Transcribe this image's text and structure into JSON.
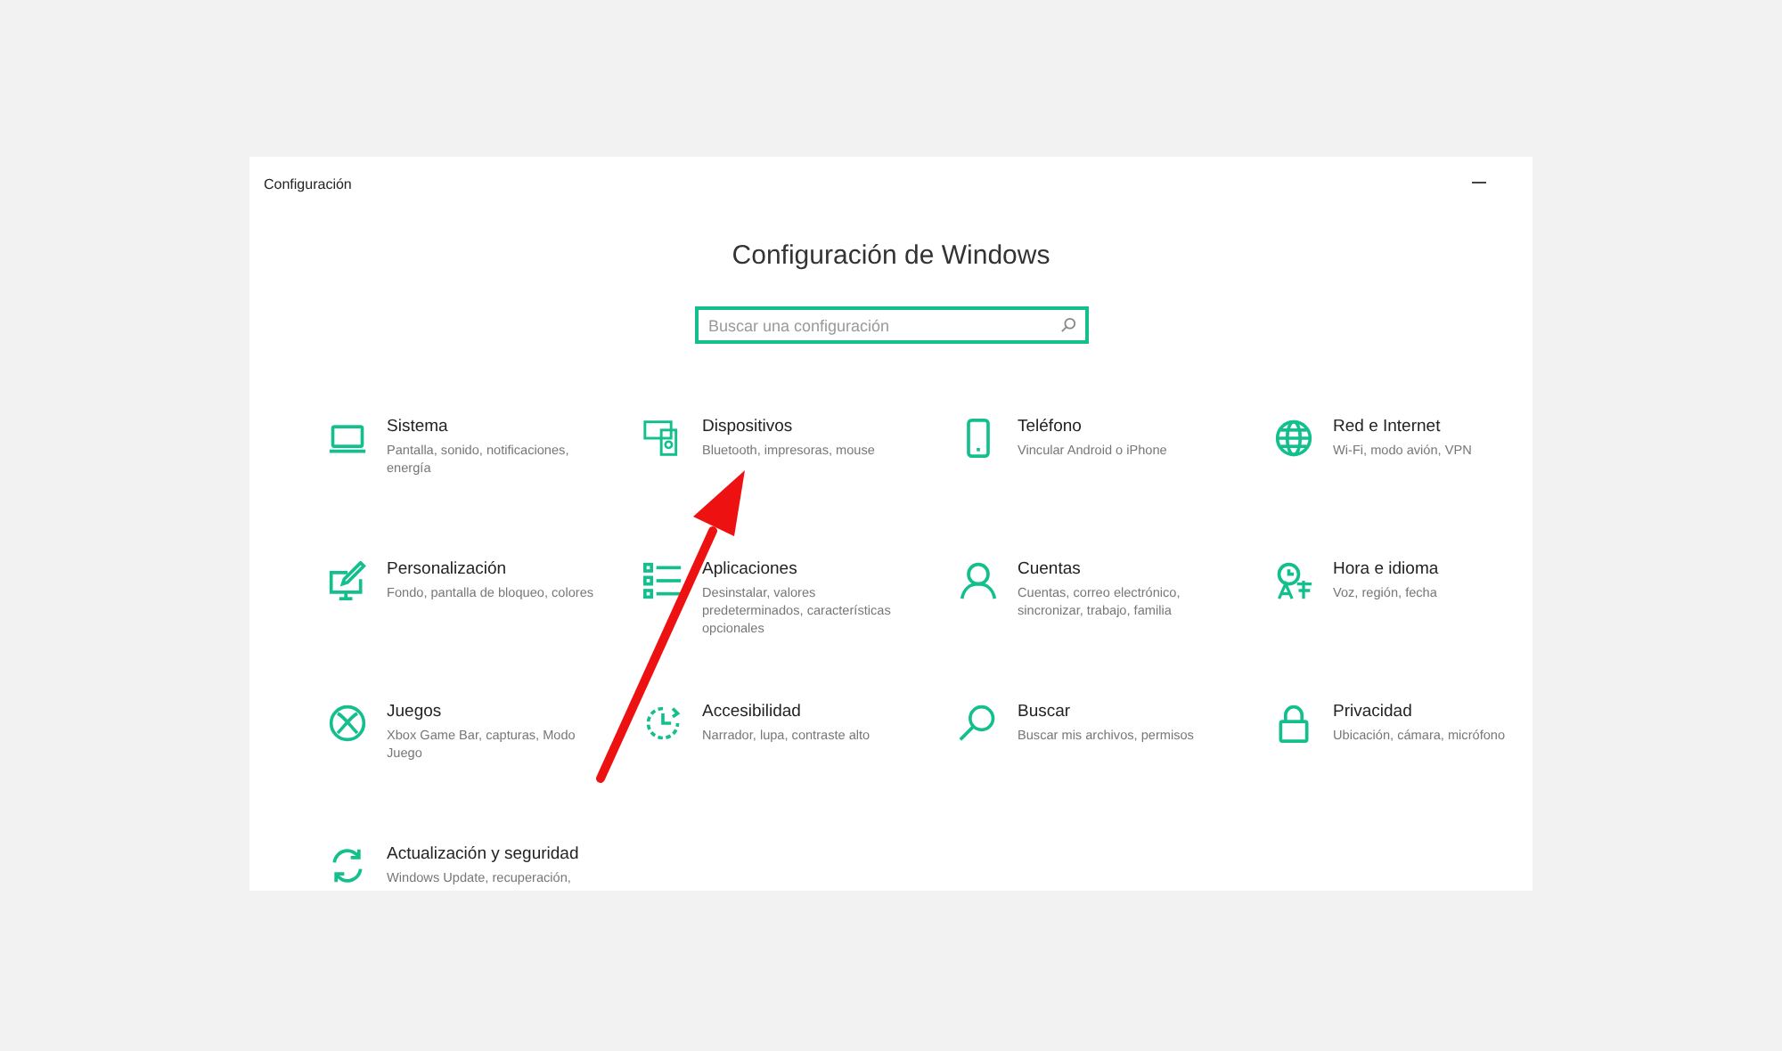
{
  "window": {
    "title": "Configuración"
  },
  "heading": "Configuración de Windows",
  "search": {
    "placeholder": "Buscar una configuración"
  },
  "categories": [
    {
      "title": "Sistema",
      "description": "Pantalla, sonido, notificaciones, energía"
    },
    {
      "title": "Dispositivos",
      "description": "Bluetooth, impresoras, mouse"
    },
    {
      "title": "Teléfono",
      "description": "Vincular Android o iPhone"
    },
    {
      "title": "Red e Internet",
      "description": "Wi-Fi, modo avión, VPN"
    },
    {
      "title": "Personalización",
      "description": "Fondo, pantalla de bloqueo, colores"
    },
    {
      "title": "Aplicaciones",
      "description": "Desinstalar, valores predeterminados, características opcionales"
    },
    {
      "title": "Cuentas",
      "description": "Cuentas, correo electrónico, sincronizar, trabajo, familia"
    },
    {
      "title": "Hora e idioma",
      "description": "Voz, región, fecha"
    },
    {
      "title": "Juegos",
      "description": "Xbox Game Bar, capturas, Modo Juego"
    },
    {
      "title": "Accesibilidad",
      "description": "Narrador, lupa, contraste alto"
    },
    {
      "title": "Buscar",
      "description": "Buscar mis archivos, permisos"
    },
    {
      "title": "Privacidad",
      "description": "Ubicación, cámara, micrófono"
    },
    {
      "title": "Actualización y seguridad",
      "description": "Windows Update, recuperación,"
    }
  ]
}
